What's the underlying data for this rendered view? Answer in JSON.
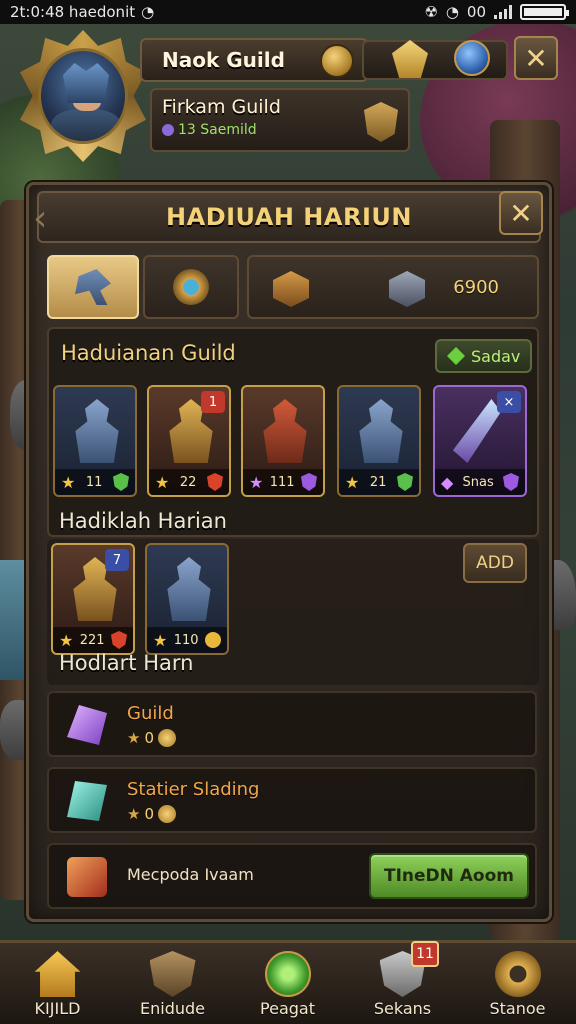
{
  "status_bar": {
    "time_text": "2t:0:48 haedonit",
    "right_text": "00"
  },
  "header": {
    "player_name": "Naok Guild",
    "guild_name": "Firkam Guild",
    "guild_members": "13 Saemild"
  },
  "panel": {
    "title": "HADIUAH HARIUN",
    "tabs": [
      {
        "icon": "hammer-icon",
        "active": true
      },
      {
        "icon": "medal-icon",
        "active": false
      },
      {
        "icon": "box-icon",
        "active": false
      },
      {
        "icon": "chest-icon",
        "count": "6900",
        "active": false
      }
    ],
    "guild_section": {
      "label": "Haduianan Guild",
      "button": "Sadav",
      "cards": [
        {
          "value": "11",
          "style": "blue"
        },
        {
          "value": "22",
          "badge": "1",
          "style": "gold"
        },
        {
          "value": "111",
          "style": "red"
        },
        {
          "value": "21",
          "style": "blue"
        },
        {
          "value": "Snas",
          "badge": "×",
          "style": "purple"
        }
      ]
    },
    "daily_section": {
      "label": "Hadiklah Harian",
      "button": "ADD",
      "cards": [
        {
          "value": "221",
          "badge": "7",
          "style": "gold"
        },
        {
          "value": "110",
          "style": "blue"
        }
      ]
    },
    "list_label": "Hodlart Harn",
    "rows": [
      {
        "title": "Guild",
        "amount": "0",
        "icon": "purple-crystal-icon"
      },
      {
        "title": "Statier Slading",
        "amount": "0",
        "icon": "cyan-crystal-icon"
      }
    ],
    "action_row": {
      "text": "Mecpoda Ivaam",
      "button": "TIneDN Aoom",
      "icon": "sword-icon"
    }
  },
  "bottom_nav": [
    {
      "label": "KIJILD",
      "icon": "house-icon"
    },
    {
      "label": "Enidude",
      "icon": "shield-icon"
    },
    {
      "label": "Peagat",
      "icon": "leaf-icon"
    },
    {
      "label": "Sekans",
      "icon": "shield-icon",
      "badge": "11"
    },
    {
      "label": "Stanoe",
      "icon": "gear-icon"
    }
  ],
  "colors": {
    "gold_text": "#f4d27a",
    "green_button": "#8ed25a",
    "panel_bg": "#3a3128"
  }
}
